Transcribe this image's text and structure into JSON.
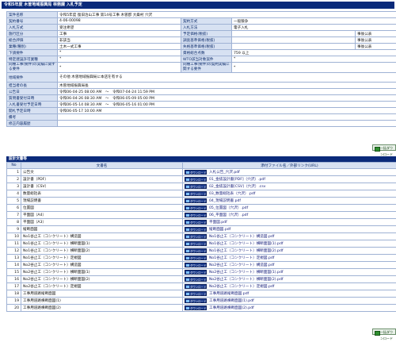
{
  "header": {
    "title": "令和5年度 木曽地域振興局 林務課 入札予定"
  },
  "info_rows": [
    {
      "l1": "案件名称",
      "v1": "令和5年度 復旧治山工事 第14号工事 木曽郡 大桑村 穴沢",
      "l2": "",
      "v2": "",
      "full": true
    },
    {
      "l1": "契約番号",
      "v1": "4-06-00098",
      "l2": "契約方式",
      "v2": "一般競争"
    },
    {
      "l1": "入札方式",
      "v1": "受注希望",
      "l2": "入札方法",
      "v2": "電子入札"
    },
    {
      "l1": "施行区分",
      "v1": "工事",
      "l2": "予定価格(税抜)",
      "v2": "",
      "n2": "事後公表"
    },
    {
      "l1": "総合評価",
      "v1": "非該当",
      "l2": "調査基準価格(税抜)",
      "v2": "",
      "n2": "事後公表"
    },
    {
      "l1": "業種(種別)",
      "v1": "土木一式工事",
      "l2": "失格基準価格(税抜)",
      "v2": "",
      "n2": "事後公表"
    },
    {
      "l1": "下請要件",
      "v1": "*",
      "l2": "資格総合点数",
      "v2": "759 以上"
    },
    {
      "l1": "特定建設許可業種",
      "v1": "*",
      "l2": "WTO該当対象案件",
      "v2": "*"
    },
    {
      "l1": "同種工事(要件)の実績に関する要件",
      "v1": "*",
      "l2": "同種工事(要件)の契約実績に関する要件",
      "v2": "*",
      "tall": true
    },
    {
      "l1": "地域要件",
      "v1": "その他 木曽地域振興局に本店を有する",
      "l2": "",
      "v2": "",
      "full": true,
      "tall2": true
    },
    {
      "l1": "担当者の長",
      "v1": "木曽地域振興局長",
      "l2": "",
      "v2": "",
      "full": true
    },
    {
      "l1": "公告日",
      "v1": "令和06-04-25 08:00 AM　～　令和07-04-24 11:59 PM",
      "l2": "",
      "v2": "",
      "full": true
    },
    {
      "l1": "質問書受付日時",
      "v1": "令和06-04-26 08:30 AM　～　令和06-05-09 05:00 PM",
      "l2": "",
      "v2": "",
      "full": true
    },
    {
      "l1": "入札書受付予定日時",
      "v1": "令和06-05-14 08:30 AM　～　令和06-05-16 01:00 PM",
      "l2": "",
      "v2": "",
      "full": true
    },
    {
      "l1": "開札予定日時",
      "v1": "令和06-05-17 10:00 AM",
      "l2": "",
      "v2": "",
      "full": true
    },
    {
      "l1": "備考",
      "v1": "",
      "l2": "",
      "v2": "",
      "full": true
    },
    {
      "l1": "修正内容履歴",
      "v1": "",
      "l2": "",
      "v2": "",
      "full": true
    }
  ],
  "bulk_download_label": "一括ダウンロード",
  "docs_section_title": "設計文書等",
  "docs_headers": {
    "no": "No",
    "name": "文書名",
    "file": "添付ファイル名／外部リンク(URL)"
  },
  "download_label": "ダウンロード",
  "documents": [
    {
      "no": "1",
      "name": "公告文",
      "file": "入札公告_穴沢.pdf"
    },
    {
      "no": "2",
      "name": "設計書（PDF）",
      "file": "01_金抜設計書[PDF]（穴沢）.pdf"
    },
    {
      "no": "3",
      "name": "設計書（CSV）",
      "file": "02_金抜設計書[CSV]（穴沢）.csv"
    },
    {
      "no": "4",
      "name": "数量総括表",
      "file": "03_数量総括表（穴沢）.pdf"
    },
    {
      "no": "5",
      "name": "現場説明書",
      "file": "04_現場説明書.pdf"
    },
    {
      "no": "6",
      "name": "位置図",
      "file": "05_位置図（穴沢）.pdf"
    },
    {
      "no": "7",
      "name": "平面図（A4）",
      "file": "06_平面図（穴沢）.pdf"
    },
    {
      "no": "8",
      "name": "平面図（A3）",
      "file": "平面図.pdf"
    },
    {
      "no": "9",
      "name": "縦断面図",
      "file": "縦断面図.pdf"
    },
    {
      "no": "10",
      "name": "No1谷止工（コンクリート）構造図",
      "file": "No1谷止工（コンクリート）構造図.pdf"
    },
    {
      "no": "11",
      "name": "No1谷止工（コンクリート）横断面図(1)",
      "file": "No1谷止工（コンクリート）横断面図(1).pdf"
    },
    {
      "no": "12",
      "name": "No1谷止工（コンクリート）横断面図(2)",
      "file": "No1谷止工（コンクリート）横断面図(2).pdf"
    },
    {
      "no": "13",
      "name": "No1谷止工（コンクリート）定規図",
      "file": "No1谷止工（コンクリート）定規図.pdf"
    },
    {
      "no": "14",
      "name": "No2谷止工（コンクリート）構造図",
      "file": "No2谷止工（コンクリート）構造図.pdf"
    },
    {
      "no": "15",
      "name": "No2谷止工（コンクリート）横断面図(1)",
      "file": "No2谷止工（コンクリート）横断面図(1).pdf"
    },
    {
      "no": "16",
      "name": "No2谷止工（コンクリート）横断面図(2)",
      "file": "No2谷止工（コンクリート）横断面図(2).pdf"
    },
    {
      "no": "17",
      "name": "No2谷止工（コンクリート）定規図",
      "file": "No2谷止工（コンクリート）定規図.pdf"
    },
    {
      "no": "18",
      "name": "工事用道路縦断面図",
      "file": "工事用道路縦断面図.pdf"
    },
    {
      "no": "19",
      "name": "工事用道路横断面図(1)",
      "file": "工事用道路横断面図(1).pdf"
    },
    {
      "no": "20",
      "name": "工事用道路横断面図(2)",
      "file": "工事用道路横断面図(2).pdf"
    }
  ]
}
